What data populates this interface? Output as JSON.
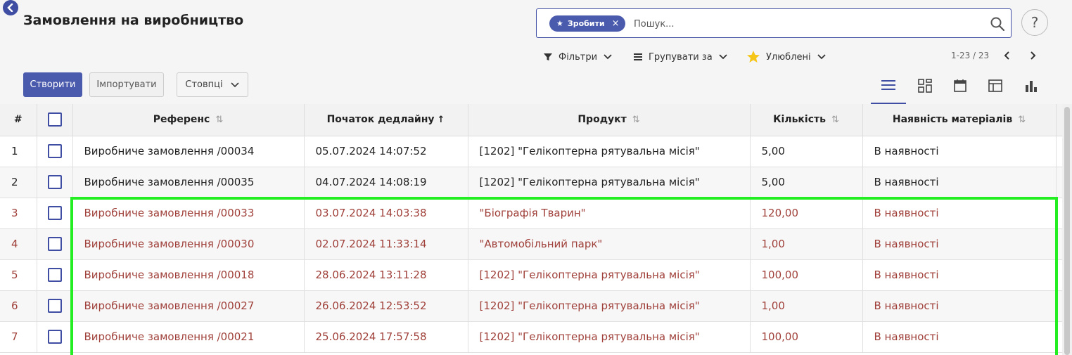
{
  "header": {
    "title": "Замовлення на виробництво",
    "help_label": "?"
  },
  "search": {
    "facet_label": "Зробити",
    "facet_remove": "×",
    "placeholder": "Пошук..."
  },
  "toolbar": {
    "filters_label": "Фільтри",
    "group_by_label": "Групувати за",
    "favorites_label": "Улюблені",
    "pager_text": "1-23 / 23",
    "favorites_color": "#f5c518"
  },
  "actions": {
    "create_label": "Створити",
    "import_label": "Імпортувати",
    "columns_label": "Стовпці"
  },
  "view_switcher": [
    "list-icon",
    "kanban-icon",
    "calendar-icon",
    "pivot-icon",
    "graph-icon"
  ],
  "table": {
    "headers": {
      "num": "#",
      "reference": "Референс",
      "deadline": "Початок дедлайну",
      "product": "Продукт",
      "quantity": "Кількість",
      "availability": "Наявність матеріалів"
    },
    "rows": [
      {
        "num": "1",
        "reference": "Виробниче замовлення /00034",
        "deadline": "05.07.2024 14:07:52",
        "product": "[1202] \"Гелікоптерна рятувальна місія\"",
        "quantity": "5,00",
        "availability": "В наявності",
        "late": false
      },
      {
        "num": "2",
        "reference": "Виробниче замовлення /00035",
        "deadline": "04.07.2024 14:08:19",
        "product": "[1202] \"Гелікоптерна рятувальна місія\"",
        "quantity": "5,00",
        "availability": "В наявності",
        "late": false
      },
      {
        "num": "3",
        "reference": "Виробниче замовлення /00033",
        "deadline": "03.07.2024 14:03:38",
        "product": "\"Біографія Тварин\"",
        "quantity": "120,00",
        "availability": "В наявності",
        "late": true
      },
      {
        "num": "4",
        "reference": "Виробниче замовлення /00030",
        "deadline": "02.07.2024 11:33:14",
        "product": "\"Автомобільний парк\"",
        "quantity": "1,00",
        "availability": "В наявності",
        "late": true
      },
      {
        "num": "5",
        "reference": "Виробниче замовлення /00018",
        "deadline": "28.06.2024 13:11:28",
        "product": "[1202] \"Гелікоптерна рятувальна місія\"",
        "quantity": "100,00",
        "availability": "В наявності",
        "late": true
      },
      {
        "num": "6",
        "reference": "Виробниче замовлення /00027",
        "deadline": "26.06.2024 12:53:52",
        "product": "[1202] \"Гелікоптерна рятувальна місія\"",
        "quantity": "1,00",
        "availability": "В наявності",
        "late": true
      },
      {
        "num": "7",
        "reference": "Виробниче замовлення /00021",
        "deadline": "25.06.2024 17:57:58",
        "product": "[1202] \"Гелікоптерна рятувальна місія\"",
        "quantity": "100,00",
        "availability": "В наявності",
        "late": true
      }
    ]
  },
  "colors": {
    "primary": "#4a5aad",
    "late_text": "#a0403a",
    "highlight": "#22ee22"
  }
}
